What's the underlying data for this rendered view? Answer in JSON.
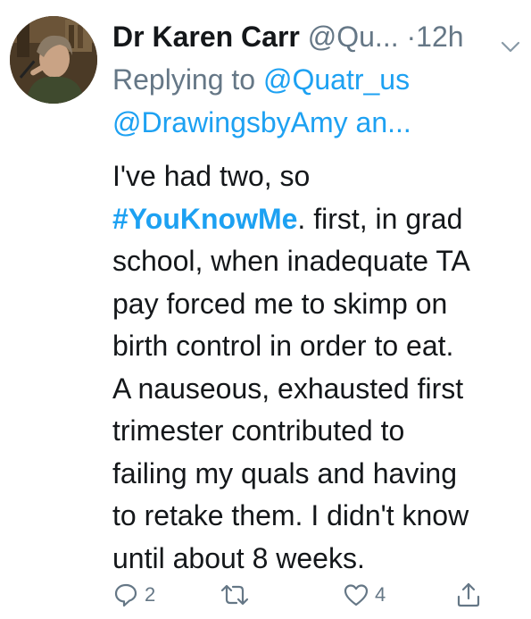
{
  "tweet": {
    "display_name": "Dr Karen Carr",
    "handle": "@Qu...",
    "dot": "·",
    "time": "12h",
    "reply_prefix": "Replying to ",
    "reply_to_first": "@Quatr_us",
    "reply_to_more": "@DrawingsbyAmy an...",
    "body_lines": [
      "I've had two, so",
      ". first, in grad",
      "school, when inadequate TA",
      "pay forced me to skimp on",
      "birth control in order to eat.",
      "A nauseous, exhausted first",
      "trimester contributed to",
      "failing my quals and having",
      "to retake them. I didn't know",
      "until about 8 weeks."
    ],
    "hashtag": "#YouKnowMe",
    "actions": {
      "reply_count": "2",
      "retweet_count": "",
      "like_count": "4"
    }
  },
  "icons": {
    "menu": "chevron-down-icon",
    "reply": "reply-icon",
    "retweet": "retweet-icon",
    "like": "heart-icon",
    "share": "share-icon"
  },
  "colors": {
    "link": "#1da1f2",
    "muted": "#657786",
    "text": "#14171a"
  }
}
